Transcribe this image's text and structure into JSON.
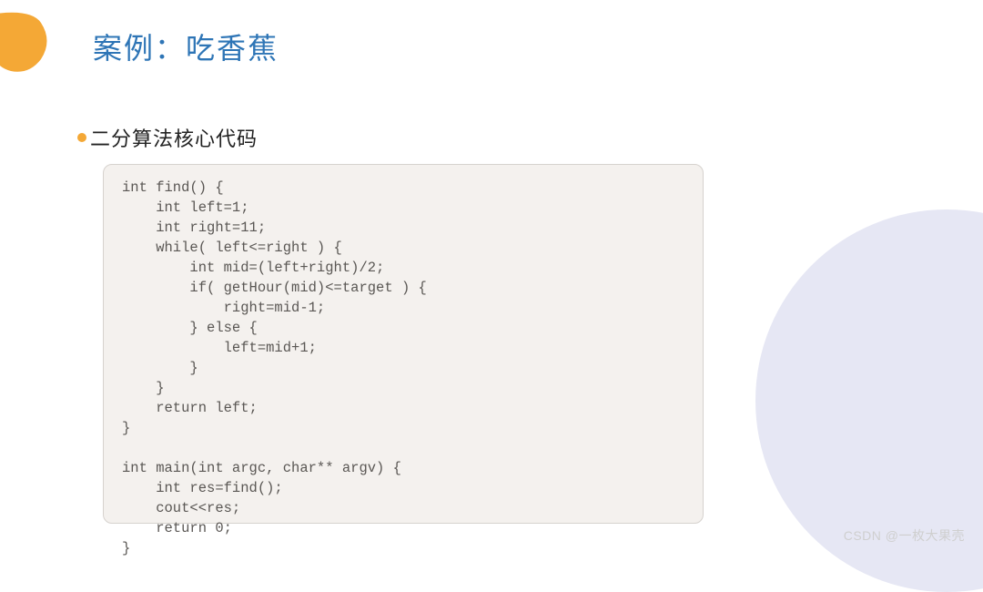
{
  "title": "案例：吃香蕉",
  "subtitle": "二分算法核心代码",
  "code": "int find() {\n    int left=1;\n    int right=11;\n    while( left<=right ) {\n        int mid=(left+right)/2;\n        if( getHour(mid)<=target ) {\n            right=mid-1;\n        } else {\n            left=mid+1;\n        }\n    }\n    return left;\n}\n\nint main(int argc, char** argv) {\n    int res=find();\n    cout<<res;\n    return 0;\n}",
  "watermark": "CSDN @一枚大果壳"
}
